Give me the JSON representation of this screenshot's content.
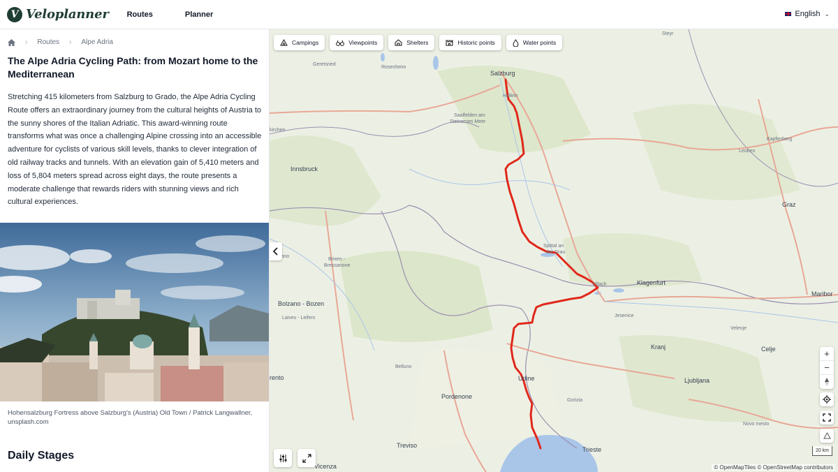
{
  "header": {
    "logo_letter": "V",
    "logo_text": "Veloplanner",
    "nav": [
      "Routes",
      "Planner"
    ],
    "language": "English"
  },
  "breadcrumb": {
    "items": [
      "Routes",
      "Alpe Adria"
    ]
  },
  "article": {
    "title": "The Alpe Adria Cycling Path: from Mozart home to the Mediterranean",
    "description": "Stretching 415 kilometers from Salzburg to Grado, the Alpe Adria Cycling Route offers an extraordinary journey from the cultural heights of Austria to the sunny shores of the Italian Adriatic. This award-winning route transforms what was once a challenging Alpine crossing into an accessible adventure for cyclists of various skill levels, thanks to clever integration of old railway tracks and tunnels. With an elevation gain of 5,410 meters and loss of 5,804 meters spread across eight days, the route presents a moderate challenge that rewards riders with stunning views and rich cultural experiences.",
    "photo_caption": "Hohensalzburg Fortress above Salzburg's (Austria) Old Town / Patrick Langwallner, unsplash.com",
    "section_heading": "Daily Stages"
  },
  "map": {
    "filters": [
      "Campings",
      "Viewpoints",
      "Shelters",
      "Historic points",
      "Water points"
    ],
    "labels": {
      "salzburg": "Salzburg",
      "hallein": "Hallein",
      "rosenheim": "Rosenheim",
      "steyr": "Steyr",
      "saalfelden": "Saalfelden am",
      "steinernes": "Steinernes Meer",
      "innsbruck": "Innsbruck",
      "leoben": "Leoben",
      "kapfenberg": "Kapfenberg",
      "graz": "Graz",
      "spittal1": "Spittal an",
      "spittal2": "der Drau",
      "villach": "Villach",
      "klagenfurt": "Klagenfurt",
      "maribor": "Maribor",
      "brixen1": "Brixen -",
      "brixen2": "Bressanone",
      "merano": "- Merano",
      "bolzano": "Bolzano - Bozen",
      "laives": "Laives - Leifers",
      "jesenice": "Jesenice",
      "velenje": "Velenje",
      "kranj": "Kranj",
      "celje": "Celje",
      "ljubljana": "Ljubljana",
      "novomesto": "Novo mesto",
      "belluno": "Belluno",
      "udine": "Udine",
      "pordenone": "Pordenone",
      "gorizia": "Gorizia",
      "trento": "rento",
      "treviso": "Treviso",
      "trieste": "Trieste",
      "vicenza": "Vicenza",
      "geretsried": "Geretsried",
      "kirchen": "kirchen"
    },
    "scale": "20 km",
    "attribution": "© OpenMapTiles © OpenStreetMap contributors"
  },
  "colors": {
    "route": "#e0281b",
    "brand": "#1f3d33",
    "water": "#a9c5e8"
  }
}
